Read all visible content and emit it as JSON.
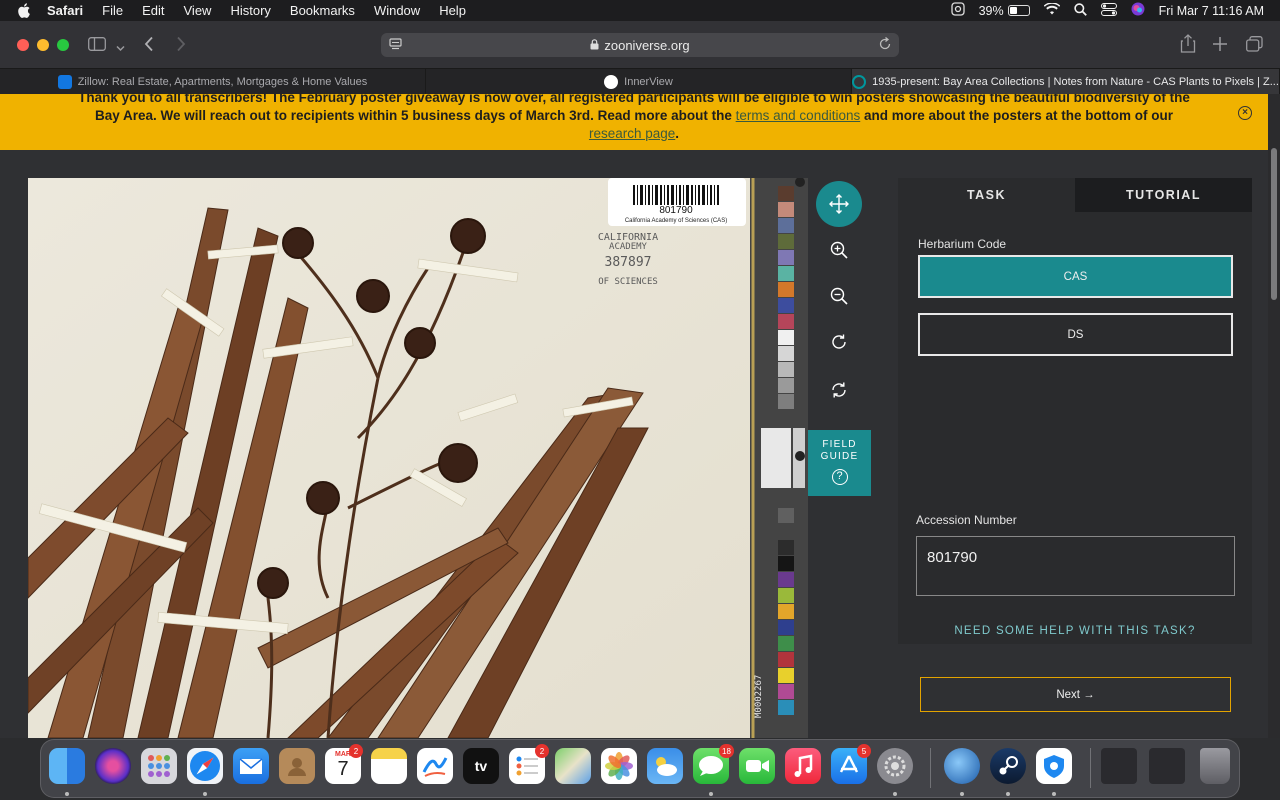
{
  "menubar": {
    "app": "Safari",
    "items": [
      "File",
      "Edit",
      "View",
      "History",
      "Bookmarks",
      "Window",
      "Help"
    ],
    "battery_pct": "39%",
    "battery_level": 0.39,
    "datetime": "Fri Mar 7  11:16 AM"
  },
  "browser": {
    "url": "zooniverse.org",
    "tabs": [
      {
        "title": "Zillow: Real Estate, Apartments, Mortgages & Home Values",
        "icon": "zillow-icon",
        "color": "#1277e1"
      },
      {
        "title": "InnerView",
        "icon": "innerview-icon",
        "color": "#ffffff"
      },
      {
        "title": "1935-present: Bay Area Collections | Notes from Nature - CAS Plants to Pixels | Z...",
        "icon": "zooniverse-icon",
        "color": "#00979d"
      }
    ]
  },
  "banner": {
    "text1": "Thank you to all transcribers! The February poster giveaway is now over, all registered participants will be eligible to win posters showcasing the beautiful biodiversity of the",
    "text2a": "Bay Area. We will reach out to recipients within 5 business days of March 3rd. Read more about the ",
    "link1": "terms and conditions",
    "text2b": " and more about the posters at the bottom of our",
    "link2": "research page",
    "text3": "."
  },
  "specimen": {
    "barcode_number": "801790",
    "barcode_caption": "California Academy of Sciences (CAS)",
    "stamp_line1": "CALIFORNIA",
    "stamp_line2": "ACADEMY",
    "stamp_number": "387897",
    "stamp_line3": "OF SCIENCES",
    "scale_code": "M0002267"
  },
  "field_guide": {
    "line1": "FIELD",
    "line2": "GUIDE",
    "icon": "?"
  },
  "task": {
    "tab_task": "TASK",
    "tab_tutorial": "TUTORIAL",
    "herbarium_label": "Herbarium Code",
    "choices": [
      "CAS",
      "DS"
    ],
    "selected": "CAS",
    "accession_label": "Accession Number",
    "accession_value": "801790",
    "help": "NEED SOME HELP WITH THIS TASK?",
    "next": "Next →"
  },
  "dock": {
    "apps": [
      "finder",
      "siri",
      "launchpad",
      "safari",
      "mail",
      "contacts",
      "calendar",
      "notes",
      "freeform",
      "tv",
      "reminders",
      "maps",
      "photos",
      "weather",
      "messages",
      "facetime",
      "music",
      "app-store",
      "system-settings",
      "network-utility",
      "steam",
      "privacy-app",
      "window-1",
      "window-2",
      "trash"
    ],
    "calendar_month": "MAR",
    "calendar_day": "7",
    "badge_calendar": "2",
    "badge_reminders": "2",
    "badge_messages": "18",
    "badge_appstore": "5",
    "tv_label": "tv"
  }
}
